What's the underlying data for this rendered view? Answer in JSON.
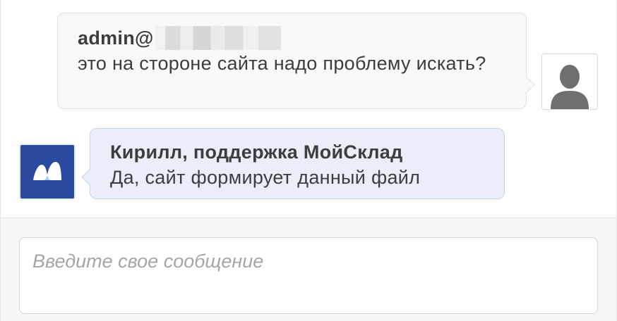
{
  "messages": [
    {
      "role": "user",
      "author": "admin@",
      "text": "это на стороне сайта надо проблему искать?",
      "avatar_icon": "user-silhouette-icon"
    },
    {
      "role": "agent",
      "author": "Кирилл, поддержка МойСклад",
      "text": "Да, сайт формирует данный файл",
      "avatar_icon": "moysklad-logo-icon"
    }
  ],
  "composer": {
    "placeholder": "Введите свое сообщение",
    "value": ""
  },
  "colors": {
    "agent_bubble": "#e9eef8",
    "user_bubble": "#f9f9f9",
    "brand": "#2a4aa0"
  }
}
